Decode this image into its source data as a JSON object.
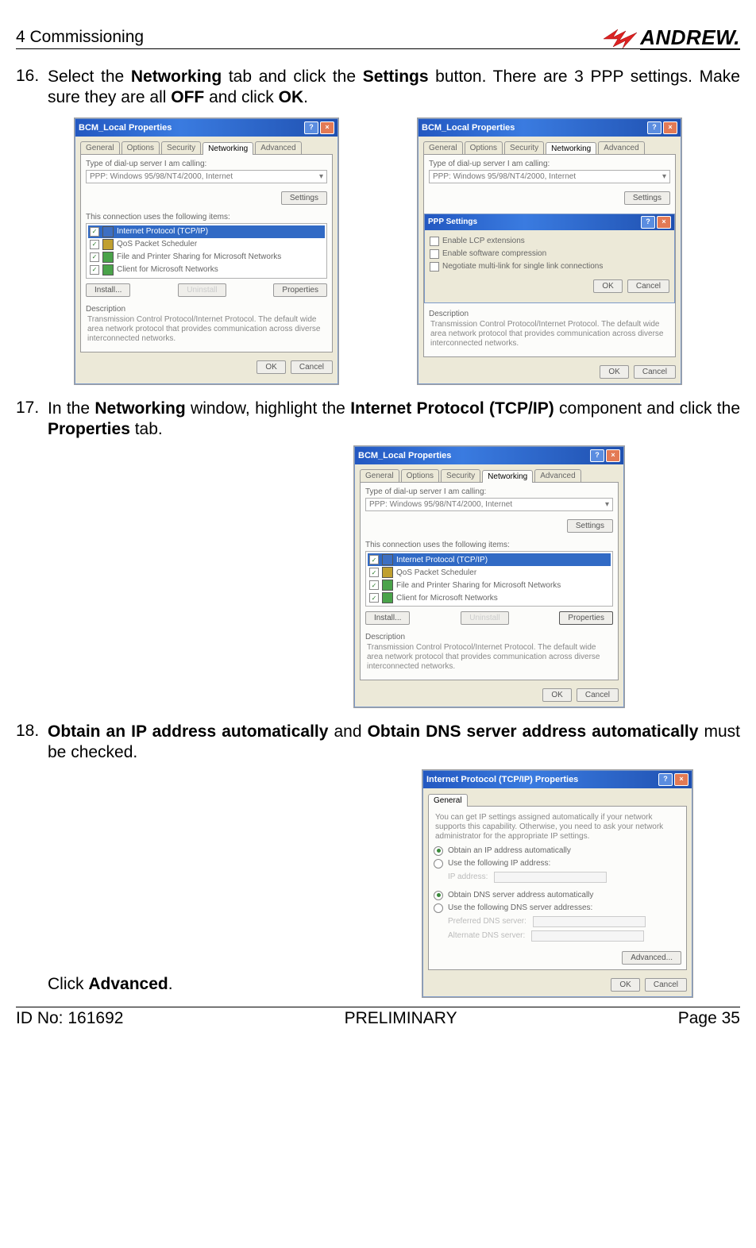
{
  "header": {
    "section": "4 Commissioning",
    "logo_text": "ANDREW."
  },
  "steps": {
    "s16": {
      "num": "16.",
      "p1_a": "Select the ",
      "p1_b": "Networking",
      "p1_c": " tab and click the ",
      "p1_d": "Settings",
      "p1_e": " button. There are 3 PPP settings. Make sure they are all ",
      "p1_f": "OFF",
      "p1_g": " and click ",
      "p1_h": "OK",
      "p1_i": "."
    },
    "s17": {
      "num": "17.",
      "p1_a": "In the ",
      "p1_b": "Networking",
      "p1_c": " window, highlight the ",
      "p1_d": "Internet Protocol (TCP/IP)",
      "p1_e": " component and click the ",
      "p1_f": "Properties",
      "p1_g": " tab."
    },
    "s18": {
      "num": "18.",
      "p1_a": "Obtain an IP address automatically",
      "p1_b": " and ",
      "p1_c": "Obtain DNS server address automatically",
      "p1_d": " must be checked.",
      "p2_a": "Click ",
      "p2_b": "Advanced",
      "p2_c": "."
    }
  },
  "dlg": {
    "local_props_title": "BCM_Local Properties",
    "tabs": {
      "general": "General",
      "options": "Options",
      "security": "Security",
      "networking": "Networking",
      "advanced": "Advanced"
    },
    "type_label": "Type of dial-up server I am calling:",
    "type_value": "PPP: Windows 95/98/NT4/2000, Internet",
    "settings_btn": "Settings",
    "conn_uses": "This connection uses the following items:",
    "items": {
      "tcpip": "Internet Protocol (TCP/IP)",
      "qos": "QoS Packet Scheduler",
      "fps": "File and Printer Sharing for Microsoft Networks",
      "client": "Client for Microsoft Networks"
    },
    "install_btn": "Install...",
    "uninstall_btn": "Uninstall",
    "properties_btn": "Properties",
    "desc_head": "Description",
    "desc_text": "Transmission Control Protocol/Internet Protocol. The default wide area network protocol that provides communication across diverse interconnected networks.",
    "ok_btn": "OK",
    "cancel_btn": "Cancel",
    "ppp_title": "PPP Settings",
    "ppp1": "Enable LCP extensions",
    "ppp2": "Enable software compression",
    "ppp3": "Negotiate multi-link for single link connections",
    "tcpip_props_title": "Internet Protocol (TCP/IP) Properties",
    "tcpip_blurb": "You can get IP settings assigned automatically if your network supports this capability. Otherwise, you need to ask your network administrator for the appropriate IP settings.",
    "r_ip_auto": "Obtain an IP address automatically",
    "r_ip_manual": "Use the following IP address:",
    "f_ip": "IP address:",
    "r_dns_auto": "Obtain DNS server address automatically",
    "r_dns_manual": "Use the following DNS server addresses:",
    "f_dns1": "Preferred DNS server:",
    "f_dns2": "Alternate DNS server:",
    "advanced_btn": "Advanced..."
  },
  "footer": {
    "left": "ID No: 161692",
    "center": "PRELIMINARY",
    "right": "Page 35"
  }
}
